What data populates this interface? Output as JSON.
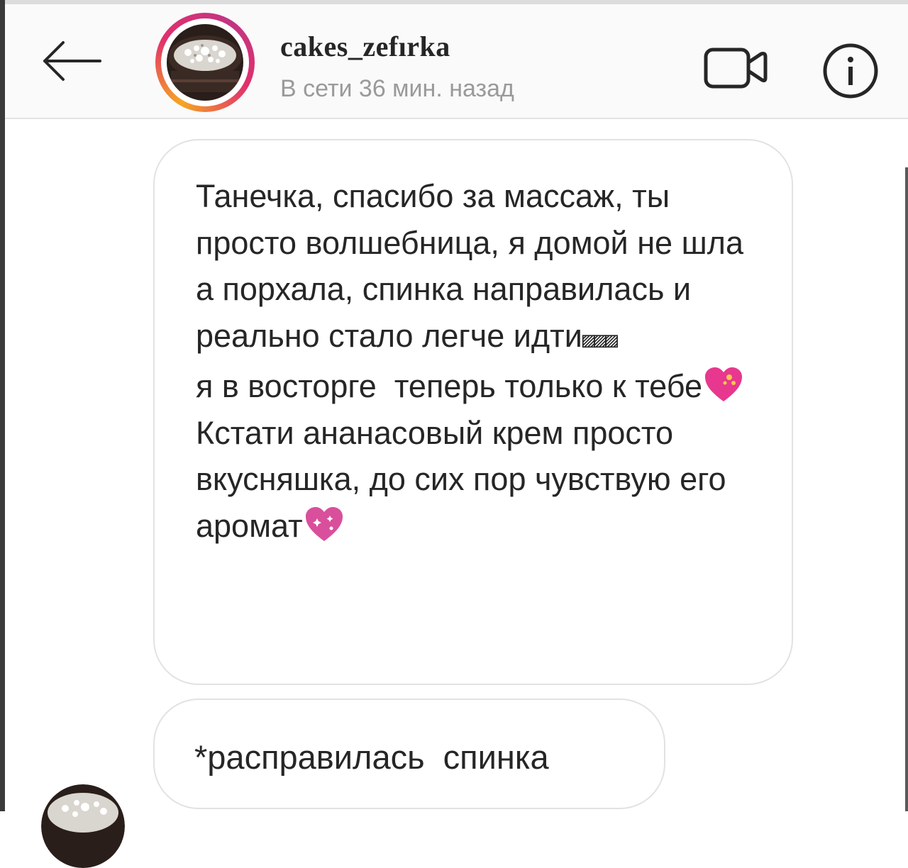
{
  "header": {
    "username": "cakes_zefırka",
    "status": "В сети 36 мин. назад",
    "icons": [
      "back-arrow-icon",
      "avatar",
      "video-call-icon",
      "info-icon"
    ]
  },
  "messages": [
    {
      "text": "Танечка, спасибо за массаж, ты просто волшебница, я домой не шла а порхала, спинка направилась и реально стало легче идти",
      "emoji_glyphs": "▨▨▨",
      "text_after_emoji": "я в восторге  теперь только к тебе",
      "text_line_cream": "Кстати ананасовый крем просто  вкусняшка, до сих пор чувствую его аромат"
    },
    {
      "text": "*расправилась  спинка"
    }
  ],
  "colors": {
    "accent_pink": "#e1306c",
    "heart_pink": "#e8378f",
    "text": "#262626",
    "muted": "#9a9a9a"
  }
}
